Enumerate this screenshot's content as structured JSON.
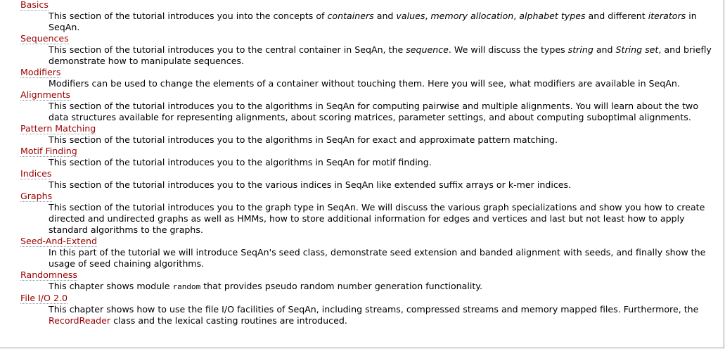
{
  "sections": [
    {
      "title": "Basics",
      "parts": [
        {
          "text": "This section of the tutorial introduces you into the concepts of "
        },
        {
          "text": "containers",
          "em": true
        },
        {
          "text": " and "
        },
        {
          "text": "values",
          "em": true
        },
        {
          "text": ", "
        },
        {
          "text": "memory allocation",
          "em": true
        },
        {
          "text": ", "
        },
        {
          "text": "alphabet types",
          "em": true
        },
        {
          "text": " and different "
        },
        {
          "text": "iterators",
          "em": true
        },
        {
          "text": " in SeqAn."
        }
      ]
    },
    {
      "title": "Sequences",
      "parts": [
        {
          "text": "This section of the tutorial introduces you to the central container in SeqAn, the "
        },
        {
          "text": "sequence",
          "em": true
        },
        {
          "text": ". We will discuss the types "
        },
        {
          "text": "string",
          "em": true
        },
        {
          "text": " and "
        },
        {
          "text": "String set",
          "em": true
        },
        {
          "text": ", and briefly demonstrate how to manipulate sequences."
        }
      ]
    },
    {
      "title": "Modifiers",
      "parts": [
        {
          "text": "Modifiers can be used to change the elements of a container without touching them. Here you will see, what modifiers are available in SeqAn."
        }
      ]
    },
    {
      "title": "Alignments",
      "parts": [
        {
          "text": "This section of the tutorial introduces you to the algorithms in SeqAn for computing pairwise and multiple alignments. You will learn about the two data structures available for representing alignments, about scoring matrices, parameter settings, and about computing suboptimal alignments."
        }
      ]
    },
    {
      "title": "Pattern Matching",
      "parts": [
        {
          "text": "This section of the tutorial introduces you to the algorithms in SeqAn for exact and approximate pattern matching."
        }
      ]
    },
    {
      "title": "Motif Finding",
      "parts": [
        {
          "text": "This section of the tutorial introduces you to the algorithms in SeqAn for motif finding."
        }
      ]
    },
    {
      "title": "Indices",
      "parts": [
        {
          "text": "This section of the tutorial introduces you to the various indices in SeqAn like extended suffix arrays or k-mer indices."
        }
      ]
    },
    {
      "title": "Graphs",
      "parts": [
        {
          "text": "This section of the tutorial introduces you to the graph type in SeqAn. We will discuss the various graph specializations and show you how to create directed and undirected graphs as well as HMMs, how to store additional information for edges and vertices and last but not least how to apply standard algorithms to the graphs."
        }
      ]
    },
    {
      "title": "Seed-And-Extend",
      "parts": [
        {
          "text": "In this part of the tutorial we will introduce SeqAn's seed class, demonstrate seed extension and banded alignment with seeds, and finally show the usage of seed chaining algorithms."
        }
      ]
    },
    {
      "title": "Randomness",
      "parts": [
        {
          "text": "This chapter shows module "
        },
        {
          "text": "random",
          "code": true
        },
        {
          "text": " that provides pseudo random number generation functionality."
        }
      ]
    },
    {
      "title": "File I/O 2.0",
      "parts": [
        {
          "text": "This chapter shows how to use the file I/O facilities of SeqAn, including streams, compressed streams and memory mapped files. Furthermore, the "
        },
        {
          "text": "RecordReader",
          "link": true
        },
        {
          "text": " class and the lexical casting routines are introduced."
        }
      ]
    }
  ]
}
